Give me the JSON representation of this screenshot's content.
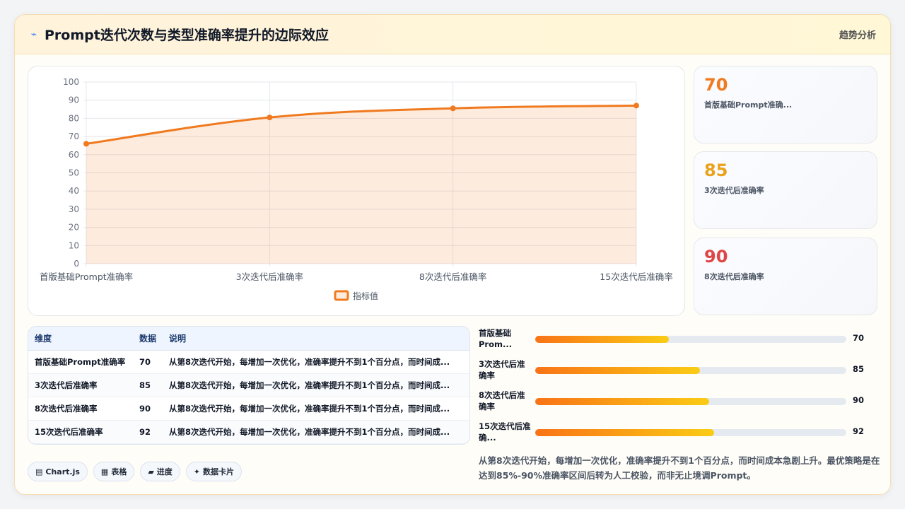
{
  "header": {
    "title": "Prompt迭代次数与类型准确率提升的边际效应",
    "title_icon": "trend-line-icon",
    "right_label": "趋势分析"
  },
  "chart_data": {
    "type": "area",
    "categories": [
      "首版基础Prompt准确率",
      "3次迭代后准确率",
      "8次迭代后准确率",
      "15次迭代后准确率"
    ],
    "series": [
      {
        "name": "指标值",
        "values": [
          66,
          80.5,
          85.5,
          87
        ]
      }
    ],
    "ylim": [
      0,
      100
    ],
    "yticks": [
      0,
      10,
      20,
      30,
      40,
      50,
      60,
      70,
      80,
      90,
      100
    ],
    "grid": true,
    "legend": "bottom",
    "color": "#f07a1f"
  },
  "kpis": [
    {
      "value": "70",
      "label": "首版基础Prompt准确...",
      "color": "#f07a1f"
    },
    {
      "value": "85",
      "label": "3次迭代后准确率",
      "color": "#eaa21b"
    },
    {
      "value": "90",
      "label": "8次迭代后准确率",
      "color": "#e04545"
    }
  ],
  "table": {
    "headers": [
      "维度",
      "数据",
      "说明"
    ],
    "rows": [
      [
        "首版基础Prompt准确率",
        "70",
        "从第8次迭代开始，每增加一次优化，准确率提升不到1个百分点，而时间成..."
      ],
      [
        "3次迭代后准确率",
        "85",
        "从第8次迭代开始，每增加一次优化，准确率提升不到1个百分点，而时间成..."
      ],
      [
        "8次迭代后准确率",
        "90",
        "从第8次迭代开始，每增加一次优化，准确率提升不到1个百分点，而时间成..."
      ],
      [
        "15次迭代后准确率",
        "92",
        "从第8次迭代开始，每增加一次优化，准确率提升不到1个百分点，而时间成..."
      ]
    ]
  },
  "pills": [
    {
      "icon": "▤",
      "label": "Chart.js"
    },
    {
      "icon": "▦",
      "label": "表格"
    },
    {
      "icon": "▰",
      "label": "进度"
    },
    {
      "icon": "✦",
      "label": "数据卡片"
    }
  ],
  "progress": [
    {
      "label": "首版基础Prom...",
      "value": "70",
      "fraction": 0.43
    },
    {
      "label": "3次迭代后准确率",
      "value": "85",
      "fraction": 0.53
    },
    {
      "label": "8次迭代后准确率",
      "value": "90",
      "fraction": 0.56
    },
    {
      "label": "15次迭代后准确...",
      "value": "92",
      "fraction": 0.575
    }
  ],
  "note": "从第8次迭代开始，每增加一次优化，准确率提升不到1个百分点，而时间成本急剧上升。最优策略是在达到85%-90%准确率区间后转为人工校验，而非无止境调Prompt。"
}
